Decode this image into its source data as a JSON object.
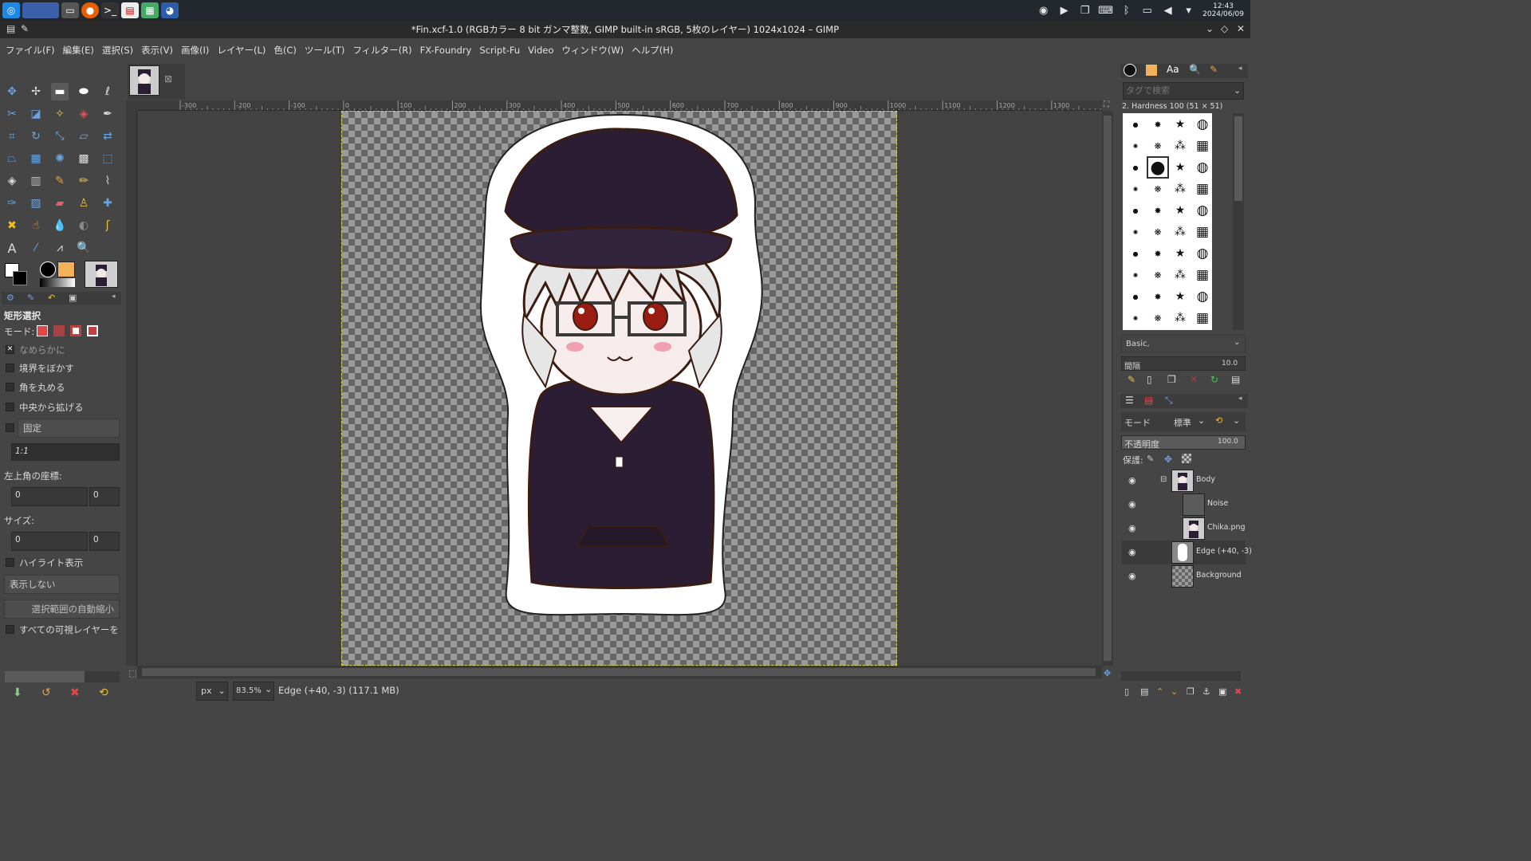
{
  "taskbar": {
    "clock_time": "12:43",
    "clock_date": "2024/06/09"
  },
  "titlebar": {
    "title": "*Fin.xcf-1.0 (RGBカラー 8 bit ガンマ整数, GIMP built-in sRGB, 5枚のレイヤー) 1024x1024 – GIMP"
  },
  "menu": [
    "ファイル(F)",
    "編集(E)",
    "選択(S)",
    "表示(V)",
    "画像(I)",
    "レイヤー(L)",
    "色(C)",
    "ツール(T)",
    "フィルター(R)",
    "FX-Foundry",
    "Script-Fu",
    "Video",
    "ウィンドウ(W)",
    "ヘルプ(H)"
  ],
  "tool_options": {
    "title": "矩形選択",
    "mode_label": "モード:",
    "antialias": "なめらかに",
    "feather": "境界をぼかす",
    "rounded": "角を丸める",
    "expand_center": "中央から拡げる",
    "fixed": "固定",
    "aspect_value": "1:1",
    "position_label": "左上角の座標:",
    "pos_x": "0",
    "pos_y": "0",
    "size_label": "サイズ:",
    "size_w": "0",
    "size_h": "0",
    "highlight": "ハイライト表示",
    "guides_value": "表示しない",
    "autoshrink": "選択範囲の自動縮小",
    "all_layers": "すべての可視レイヤーを"
  },
  "ruler": {
    "labels": [
      "-300",
      "-200",
      "-100",
      "0",
      "100",
      "200",
      "300",
      "400",
      "500",
      "600",
      "700",
      "800",
      "900",
      "1000",
      "1100",
      "1200",
      "1300"
    ]
  },
  "statusbar": {
    "unit": "px",
    "zoom": "83.5%",
    "message": "Edge (+40, -3) (117.1 MB)"
  },
  "brushes": {
    "tag_placeholder": "タグで検索",
    "current": "2. Hardness 100 (51 × 51)",
    "preset": "Basic,",
    "spacing_label": "間隔",
    "spacing_value": "10.0"
  },
  "layers": {
    "mode_label": "モード",
    "mode_value": "標準",
    "opacity_label": "不透明度",
    "opacity_value": "100.0",
    "lock_label": "保護:",
    "items": [
      {
        "name": "Body"
      },
      {
        "name": "Noise"
      },
      {
        "name": "Chika.png"
      },
      {
        "name": "Edge (+40, -3)"
      },
      {
        "name": "Background"
      }
    ]
  },
  "colors": {
    "accent": "#6aa3e0",
    "selection": "#d8d84a",
    "hoodie": "#2b1d33",
    "outline": "#3a1c10"
  }
}
